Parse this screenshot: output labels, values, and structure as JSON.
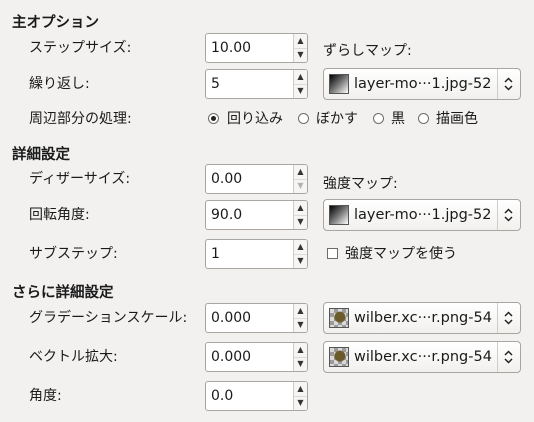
{
  "main_options": {
    "title": "主オプション",
    "step_size": {
      "label": "ステップサイズ:",
      "value": "10.00"
    },
    "displace_map": {
      "label": "ずらしマップ:",
      "selected": "layer-mo···1.jpg-52",
      "icon": "gradient-thumbnail-icon"
    },
    "iterations": {
      "label": "繰り返し:",
      "value": "5"
    },
    "edge_behavior": {
      "label": "周辺部分の処理:",
      "options": [
        "回り込み",
        "ぼかす",
        "黒",
        "描画色"
      ],
      "selected": "回り込み"
    }
  },
  "advanced": {
    "title": "詳細設定",
    "dither_size": {
      "label": "ディザーサイズ:",
      "value": "0.00"
    },
    "magnitude_map": {
      "label": "強度マップ:",
      "selected": "layer-mo···1.jpg-52",
      "icon": "gradient-thumbnail-icon"
    },
    "rotation": {
      "label": "回転角度:",
      "value": "90.0"
    },
    "substeps": {
      "label": "サブステップ:",
      "value": "1"
    },
    "use_magnitude_map": {
      "label": "強度マップを使う",
      "checked": false
    }
  },
  "more_advanced": {
    "title": "さらに詳細設定",
    "gradient_scale": {
      "label": "グラデーションスケール:",
      "value": "0.000",
      "map": "wilber.xc···r.png-54",
      "icon": "wilber-thumbnail-icon"
    },
    "vector_scale": {
      "label": "ベクトル拡大:",
      "value": "0.000",
      "map": "wilber.xc···r.png-54",
      "icon": "wilber-thumbnail-icon"
    },
    "angle": {
      "label": "角度:",
      "value": "0.0"
    }
  },
  "colors": {
    "background": "#f2f1f0",
    "text": "#1a1a1a",
    "border": "#a9a6a2"
  }
}
